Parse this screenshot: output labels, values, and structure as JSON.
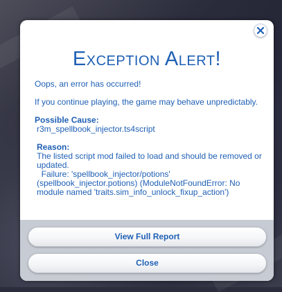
{
  "dialog": {
    "title": "Exception Alert!",
    "close_icon": "close-icon",
    "intro": "Oops, an error has occurred!",
    "continue_warning": "If you continue playing, the game may behave unpredictably.",
    "cause_label": "Possible Cause:",
    "cause_value": "r3m_spellbook_injector.ts4script",
    "reason_label": "Reason:",
    "reason_text": "The listed script mod failed to load and should be removed or updated.",
    "failure_text": "Failure: 'spellbook_injector/potions' (spellbook_injector.potions) (ModuleNotFoundError: No module named 'traits.sim_info_unlock_fixup_action')"
  },
  "buttons": {
    "view_report": "View Full Report",
    "close": "Close"
  },
  "colors": {
    "accent": "#1e5fb4",
    "dialog_bg": "#ffffff",
    "footer_bg": "#c7cbd3"
  }
}
